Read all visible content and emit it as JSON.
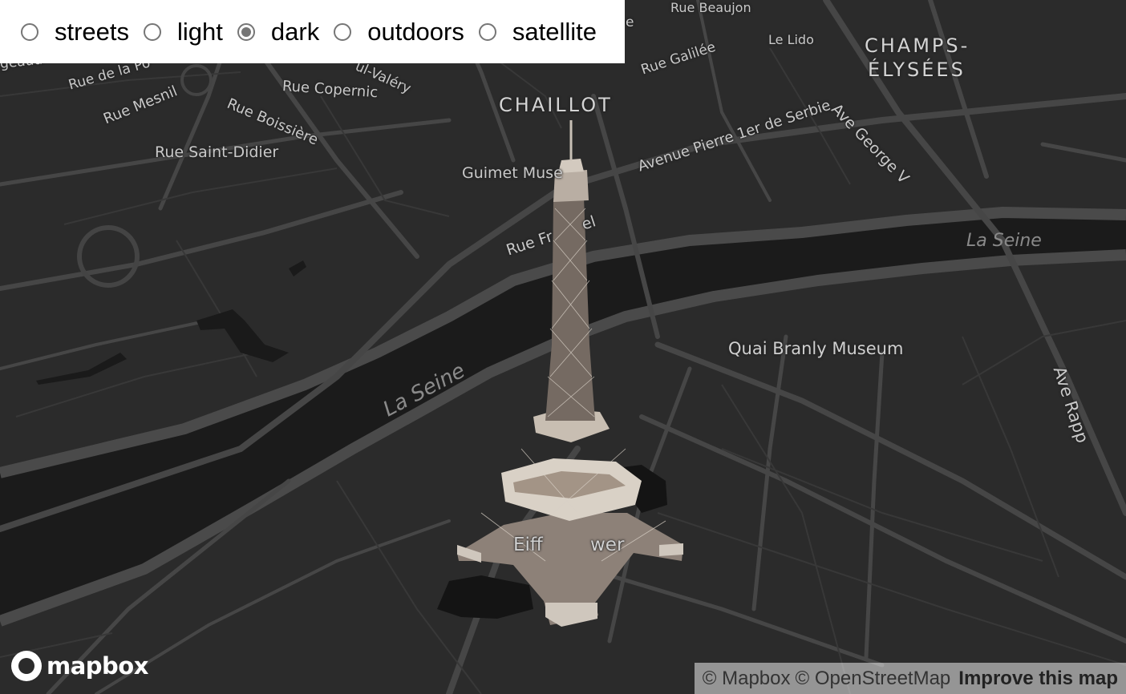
{
  "style_switcher": {
    "options": [
      {
        "label": "streets",
        "checked": false
      },
      {
        "label": "light",
        "checked": false
      },
      {
        "label": "dark",
        "checked": true
      },
      {
        "label": "outdoors",
        "checked": false
      },
      {
        "label": "satellite",
        "checked": false
      }
    ]
  },
  "map": {
    "district_labels": [
      "CHAILLOT",
      "CHAMPS-",
      "ÉLYSÉES"
    ],
    "street_labels": [
      "Rue Beaujon",
      "Le Lido",
      "Rue Galilée",
      "Ave George V",
      "Avenue Pierre 1er de Serbie",
      "Rue de la Po",
      "Rue Mesnil",
      "Rue Copernic",
      "Rue Boissière",
      "Rue Saint-Didier",
      "Guimet Muse",
      "Rue Fr",
      "el",
      "Ave Rapp",
      "geaud",
      "ul-Valéry",
      "e"
    ],
    "water_labels": [
      "La Seine",
      "La Seine"
    ],
    "poi_labels": [
      "Quai Branly Museum",
      "Eiff",
      "wer"
    ],
    "colors": {
      "background": "#2b2b2b",
      "water": "#1c1c1c",
      "road": "#454545",
      "label": "#c9c9c9"
    }
  },
  "logo": {
    "text": "mapbox"
  },
  "attribution": {
    "mapbox": "© Mapbox",
    "osm": "© OpenStreetMap",
    "improve": "Improve this map"
  }
}
